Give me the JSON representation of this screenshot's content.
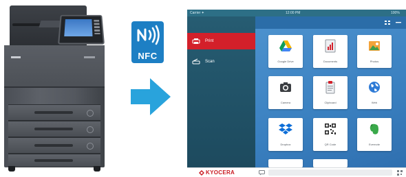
{
  "nfc_badge": {
    "label": "NFC",
    "color": "#1d7fc4"
  },
  "arrow": {
    "color": "#29a3dc"
  },
  "tablet": {
    "status_bar": {
      "left": "Carrier ✦",
      "center": "12:00 PM",
      "right": "100%"
    },
    "sidebar": {
      "items": [
        {
          "label": "Print",
          "icon": "printer-icon",
          "active": true
        },
        {
          "label": "Scan",
          "icon": "scanner-icon",
          "active": false
        }
      ]
    },
    "apps": [
      {
        "label": "Google Drive",
        "icon": "google-drive-icon"
      },
      {
        "label": "Documents",
        "icon": "documents-icon"
      },
      {
        "label": "Photos",
        "icon": "photos-icon"
      },
      {
        "label": "Camera",
        "icon": "camera-icon"
      },
      {
        "label": "Clipboard",
        "icon": "clipboard-icon"
      },
      {
        "label": "Web",
        "icon": "web-icon"
      },
      {
        "label": "Dropbox",
        "icon": "dropbox-icon"
      },
      {
        "label": "QR Code",
        "icon": "qr-code-icon"
      },
      {
        "label": "Evernote",
        "icon": "evernote-icon"
      }
    ],
    "brand": "KYOCERA"
  },
  "colors": {
    "sidebar": "#265c72",
    "active": "#d3202a",
    "main": "#3a80c0",
    "brand": "#c91a22"
  }
}
